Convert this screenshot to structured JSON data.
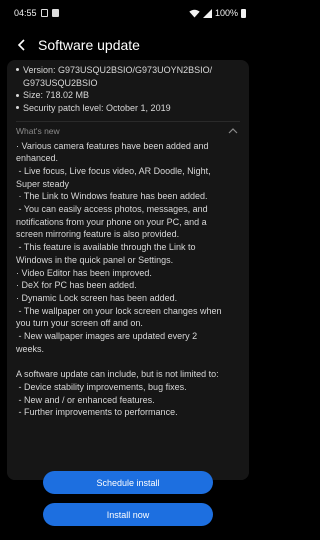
{
  "status_bar": {
    "time": "04:55",
    "battery": "100%",
    "icons": [
      "notification-icon",
      "sim-icon",
      "wifi-icon",
      "signal-icon",
      "battery-icon"
    ]
  },
  "header": {
    "back_icon": "back-arrow-icon",
    "title": "Software update"
  },
  "info": {
    "version_line1": "Version: G973USQU2BSIO/G973UOYN2BSIO/",
    "version_line2": "G973USQU2BSIO",
    "size": "Size: 718.02 MB",
    "security_patch": "Security patch level: October 1, 2019"
  },
  "whats_new": {
    "label": "What's new",
    "chevron_icon": "chevron-up-icon"
  },
  "notes": [
    "· Various camera features have been added and",
    "enhanced.",
    " - Live focus, Live focus video, AR Doodle, Night,",
    "Super steady",
    " · The Link to Windows feature has been added.",
    " - You can easily access photos, messages, and",
    "notifications from your phone on your PC, and a",
    "screen mirroring feature is also provided.",
    " - This feature is available through the Link to",
    "Windows in the quick panel or Settings.",
    "· Video Editor has been improved.",
    "· DeX for PC has been added.",
    "· Dynamic Lock screen has been added.",
    " - The wallpaper on your lock screen changes when",
    "you turn your screen off and on.",
    " - New wallpaper images are updated every 2",
    "weeks.",
    "",
    "A software update can include, but is not limited to:",
    " - Device stability improvements, bug fixes.",
    " - New and / or enhanced features.",
    " - Further improvements to performance."
  ],
  "buttons": {
    "schedule": "Schedule install",
    "install_now": "Install now"
  },
  "colors": {
    "background": "#000000",
    "card": "#161616",
    "accent": "#1d6fe0"
  }
}
